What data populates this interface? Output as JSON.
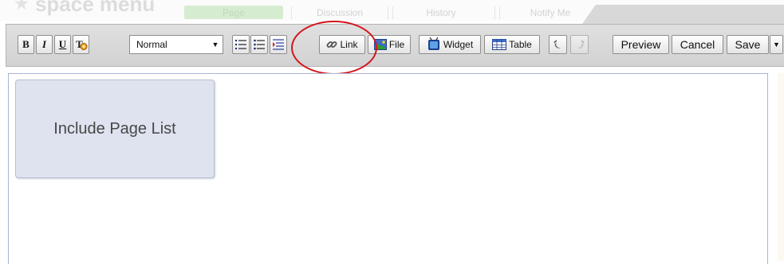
{
  "header": {
    "page_title": "space menu",
    "tabs": [
      {
        "label": "Page",
        "active": true
      },
      {
        "label": "Discussion",
        "active": false
      },
      {
        "label": "History",
        "active": false
      },
      {
        "label": "Notify Me",
        "active": false
      }
    ]
  },
  "toolbar": {
    "bold_label": "B",
    "italic_label": "I",
    "underline_label": "U",
    "format_select": {
      "value": "Normal",
      "arrow": "▼"
    },
    "link_label": "Link",
    "file_label": "File",
    "widget_label": "Widget",
    "table_label": "Table",
    "preview_label": "Preview",
    "cancel_label": "Cancel",
    "save_label": "Save",
    "save_arrow": "▼"
  },
  "content": {
    "macro_label": "Include Page List"
  },
  "colors": {
    "annotation": "#d5151b",
    "macro_bg": "#dfe3f0",
    "active_tab": "#d6ecd0"
  }
}
